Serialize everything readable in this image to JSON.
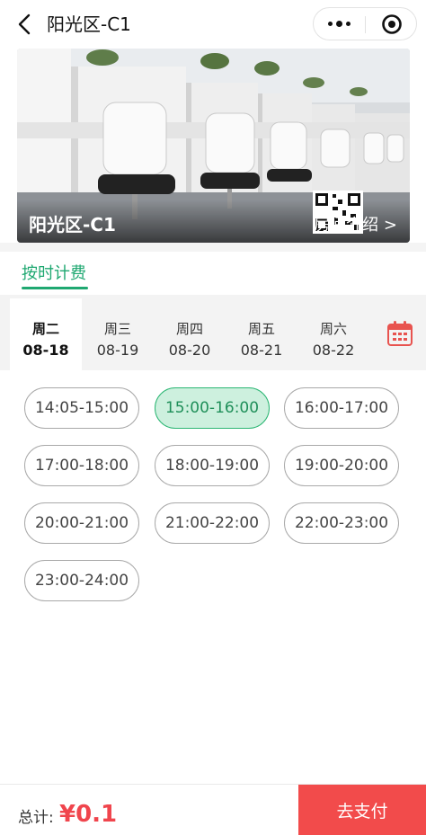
{
  "header": {
    "title": "阳光区-C1",
    "back_icon": "chevron-left-icon",
    "more_icon": "more-dots-icon",
    "close_icon": "target-circle-icon"
  },
  "banner": {
    "room_name": "阳光区-C1",
    "intro_label": "房间介绍 >"
  },
  "billing": {
    "tab_label": "按时计费",
    "accent_color": "#1fa871"
  },
  "days": [
    {
      "week": "周二",
      "date": "08-18",
      "active": true
    },
    {
      "week": "周三",
      "date": "08-19",
      "active": false
    },
    {
      "week": "周四",
      "date": "08-20",
      "active": false
    },
    {
      "week": "周五",
      "date": "08-21",
      "active": false
    },
    {
      "week": "周六",
      "date": "08-22",
      "active": false
    }
  ],
  "calendar_icon": "calendar-icon",
  "slots": [
    {
      "label": "14:05-15:00",
      "selected": false
    },
    {
      "label": "15:00-16:00",
      "selected": true
    },
    {
      "label": "16:00-17:00",
      "selected": false
    },
    {
      "label": "17:00-18:00",
      "selected": false
    },
    {
      "label": "18:00-19:00",
      "selected": false
    },
    {
      "label": "19:00-20:00",
      "selected": false
    },
    {
      "label": "20:00-21:00",
      "selected": false
    },
    {
      "label": "21:00-22:00",
      "selected": false
    },
    {
      "label": "22:00-23:00",
      "selected": false
    },
    {
      "label": "23:00-24:00",
      "selected": false
    }
  ],
  "footer": {
    "total_label": "总计:",
    "total_value": "¥0.1",
    "pay_label": "去支付",
    "pay_color": "#f24b4b"
  }
}
